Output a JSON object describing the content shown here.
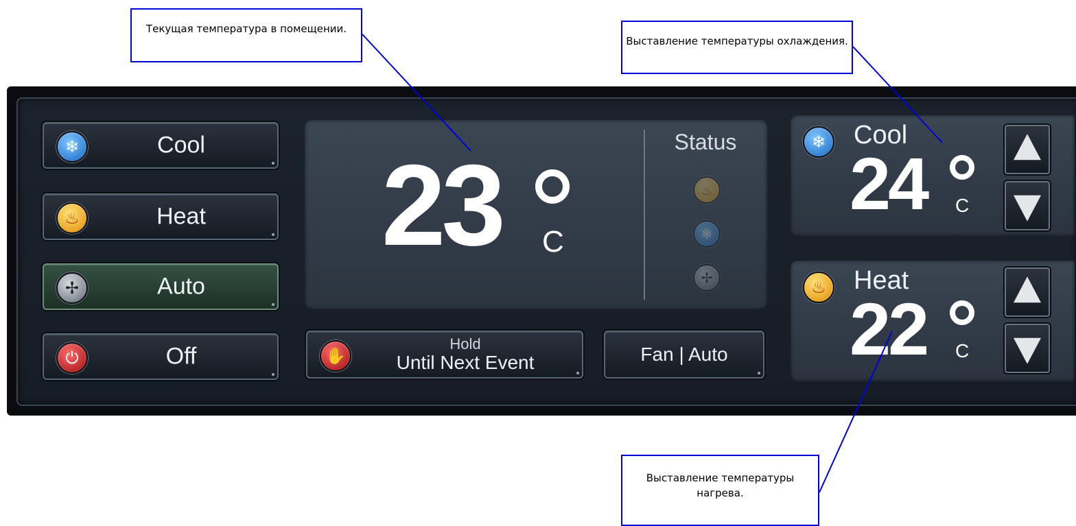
{
  "modes": [
    {
      "label": "Cool",
      "icon": "snowflake-icon"
    },
    {
      "label": "Heat",
      "icon": "flame-icon"
    },
    {
      "label": "Auto",
      "icon": "fan-icon",
      "active": true
    },
    {
      "label": "Off",
      "icon": "power-icon"
    }
  ],
  "current": {
    "temperature": "23",
    "unit": "C",
    "status_label": "Status",
    "status_icons": [
      "flame-icon",
      "snowflake-icon",
      "fan-icon"
    ]
  },
  "hold_button": {
    "line1": "Hold",
    "line2": "Until Next Event",
    "icon": "hand-stop-icon"
  },
  "fan_button": {
    "label": "Fan | Auto"
  },
  "setpoints": {
    "cool": {
      "label": "Cool",
      "temperature": "24",
      "unit": "C",
      "icon": "snowflake-icon"
    },
    "heat": {
      "label": "Heat",
      "temperature": "22",
      "unit": "C",
      "icon": "flame-icon"
    }
  },
  "annotations": {
    "current_temp": "Текущая температура в помещении.",
    "cool_setpoint": "Выставление температуры охлаждения.",
    "heat_setpoint": "Выставление температуры нагрева."
  },
  "colors": {
    "annotation_border": "#0000dd",
    "active_mode": "#345143",
    "panel": "#161d26"
  }
}
